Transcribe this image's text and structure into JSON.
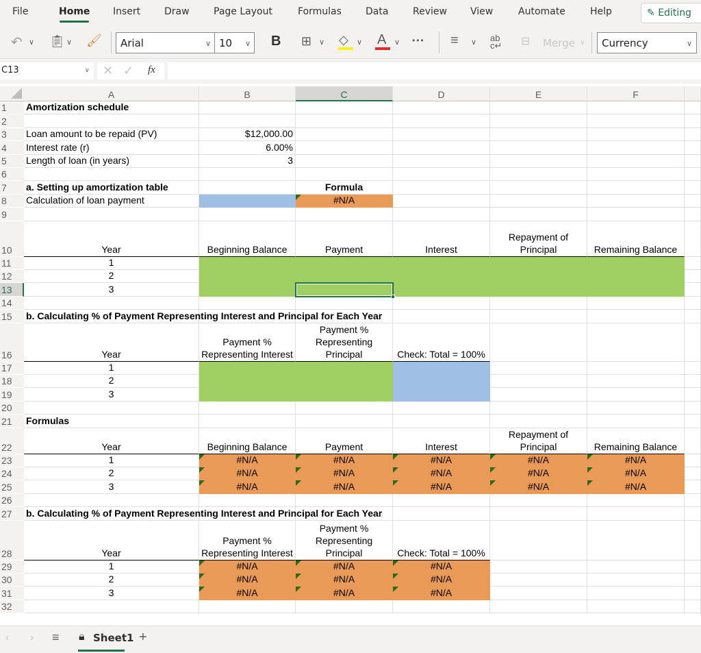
{
  "ribbon": {
    "tabs": [
      "File",
      "Home",
      "Insert",
      "Draw",
      "Page Layout",
      "Formulas",
      "Data",
      "Review",
      "View",
      "Automate",
      "Help"
    ],
    "active_tab": "Home",
    "editing_label": "Editing"
  },
  "toolbar": {
    "font_name": "Arial",
    "font_size": "10",
    "bold_label": "B",
    "merge_label": "Merge",
    "number_format": "Currency",
    "more_label": "•••",
    "accent_colors": {
      "highlight": "#fff200",
      "font_color": "#e02b2b",
      "brand": "#217346"
    }
  },
  "formula_bar": {
    "name_box": "C13",
    "fx_label": "fx",
    "value": ""
  },
  "columns": [
    "A",
    "B",
    "C",
    "D",
    "E",
    "F"
  ],
  "selected_column": "C",
  "selected_row": "13",
  "rows": [
    "1",
    "2",
    "3",
    "4",
    "5",
    "6",
    "7",
    "8",
    "9",
    "10",
    "11",
    "12",
    "13",
    "14",
    "15",
    "16",
    "17",
    "18",
    "19",
    "20",
    "21",
    "22",
    "23",
    "24",
    "25",
    "26",
    "27",
    "28",
    "29",
    "30",
    "31",
    "32"
  ],
  "sheet": {
    "title": "Amortization schedule",
    "inputs": [
      {
        "label": "Loan amount to be repaid (PV)",
        "value": "$12,000.00"
      },
      {
        "label": "Interest rate  (r)",
        "value": "6.00%"
      },
      {
        "label": "Length of loan (in years)",
        "value": "3"
      }
    ],
    "section_a": "a.  Setting up amortization table",
    "formula_header": "Formula",
    "loan_payment_label": "Calculation of loan payment",
    "loan_payment_formula": "#N/A",
    "table_a_headers": [
      "Year",
      "Beginning Balance",
      "Payment",
      "Interest",
      "Repayment of Principal",
      "Remaining Balance"
    ],
    "years": [
      "1",
      "2",
      "3"
    ],
    "section_b": "b.  Calculating % of Payment Representing Interest and Principal for Each Year",
    "table_b_headers": [
      "Year",
      "Payment % Representing Interest",
      "Payment % Representing Principal",
      "Check:  Total = 100%"
    ],
    "formulas_label": "Formulas",
    "error_value": "#N/A"
  },
  "sheet_tabs": {
    "active": "Sheet1",
    "add_label": "+"
  }
}
